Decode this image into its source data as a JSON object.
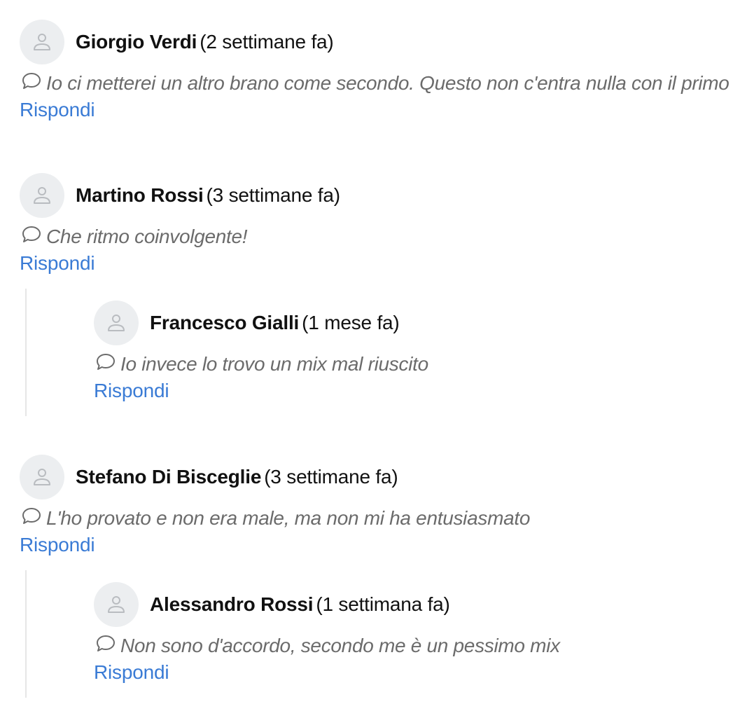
{
  "comments": [
    {
      "author": "Giorgio Verdi",
      "time": "(2 settimane fa)",
      "text": "Io ci metterei un altro brano come secondo. Questo non c'entra nulla con il primo",
      "reply_label": "Rispondi"
    },
    {
      "author": "Martino Rossi",
      "time": "(3 settimane fa)",
      "text": "Che ritmo coinvolgente!",
      "reply_label": "Rispondi",
      "replies": [
        {
          "author": "Francesco Gialli",
          "time": "(1 mese fa)",
          "text": "Io invece lo trovo un mix mal riuscito",
          "reply_label": "Rispondi"
        }
      ]
    },
    {
      "author": "Stefano Di Bisceglie",
      "time": "(3 settimane fa)",
      "text": "L'ho provato e non era male, ma non mi ha entusiasmato",
      "reply_label": "Rispondi",
      "replies": [
        {
          "author": "Alessandro Rossi",
          "time": "(1 settimana fa)",
          "text": "Non sono d'accordo, secondo me è un pessimo mix",
          "reply_label": "Rispondi"
        }
      ]
    }
  ],
  "icons": {
    "avatar": "user-icon",
    "comment": "speech-bubble-icon"
  },
  "colors": {
    "link": "#3a7bd5",
    "comment_text": "#6b6b6b",
    "avatar_bg": "#eceef0",
    "rail": "#e6e6e6"
  }
}
